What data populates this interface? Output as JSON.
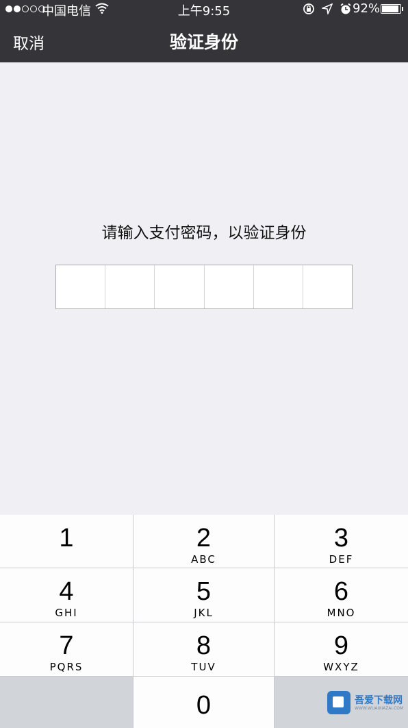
{
  "status_bar": {
    "carrier": "中国电信",
    "time": "上午9:55",
    "battery": "92%",
    "battery_level": 0.92,
    "signal_strength": 2
  },
  "nav": {
    "cancel_label": "取消",
    "title": "验证身份"
  },
  "prompt": "请输入支付密码，以验证身份",
  "pin_length": 6,
  "keypad": {
    "keys": [
      {
        "num": "1",
        "letters": ""
      },
      {
        "num": "2",
        "letters": "ABC"
      },
      {
        "num": "3",
        "letters": "DEF"
      },
      {
        "num": "4",
        "letters": "GHI"
      },
      {
        "num": "5",
        "letters": "JKL"
      },
      {
        "num": "6",
        "letters": "MNO"
      },
      {
        "num": "7",
        "letters": "PQRS"
      },
      {
        "num": "8",
        "letters": "TUV"
      },
      {
        "num": "9",
        "letters": "WXYZ"
      },
      {
        "num": "0",
        "letters": ""
      }
    ]
  },
  "watermark": {
    "name": "吾爱下载网",
    "url": "WWW.WUAIXIAZAI.COM"
  }
}
